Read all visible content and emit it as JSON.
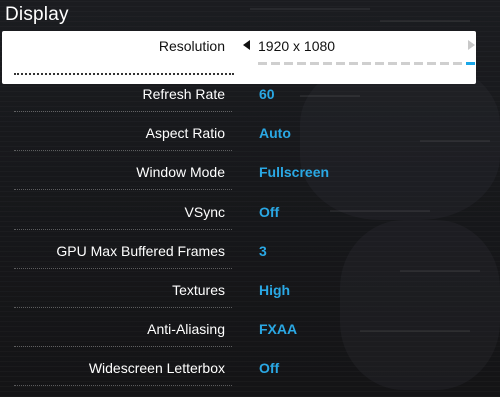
{
  "section_title": "Display",
  "resolution": {
    "label": "Resolution",
    "value": "1920 x 1080",
    "options_count": 17,
    "selected_index": 16
  },
  "settings": [
    {
      "label": "Refresh Rate",
      "value": "60"
    },
    {
      "label": "Aspect Ratio",
      "value": "Auto"
    },
    {
      "label": "Window Mode",
      "value": "Fullscreen"
    },
    {
      "label": "VSync",
      "value": "Off"
    },
    {
      "label": "GPU Max Buffered Frames",
      "value": "3"
    },
    {
      "label": "Textures",
      "value": "High"
    },
    {
      "label": "Anti-Aliasing",
      "value": "FXAA"
    },
    {
      "label": "Widescreen Letterbox",
      "value": "Off"
    }
  ],
  "colors": {
    "value_accent": "#2aa8e4",
    "selected_bg": "#ffffff",
    "page_bg": "#151518"
  }
}
